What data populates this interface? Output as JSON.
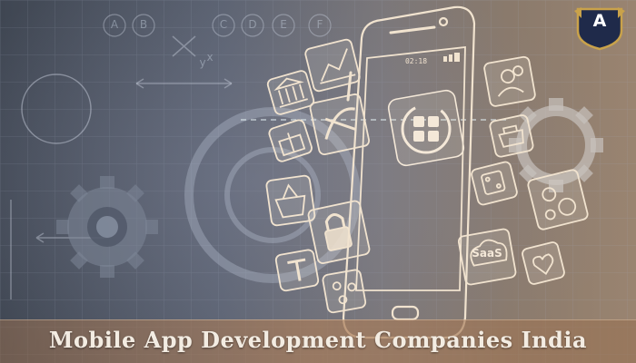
{
  "caption": "Mobile App Development Companies India",
  "logo_letter": "A",
  "phone_time": "02:18",
  "saas_label": "SaaS",
  "grid_letters": [
    "A",
    "B",
    "C",
    "D",
    "E",
    "F"
  ],
  "axis_letters": {
    "x": "x",
    "y": "y"
  },
  "colors": {
    "line_light": "#f1e3cf",
    "grid": "#9aa6b8",
    "logo_shield": "#1f2a4a",
    "logo_rim": "#c9a24a",
    "caption_text": "#f3ece2"
  },
  "icons": [
    "growth-chart-icon",
    "bank-icon",
    "lock-icon",
    "gift-icon",
    "shopping-basket-icon",
    "padlock-icon",
    "pen-tool-icon",
    "people-icon",
    "toolbox-icon",
    "dice-icon",
    "share-icon",
    "saas-icon",
    "heart-icon",
    "app-grid-icon",
    "gear-icon"
  ]
}
